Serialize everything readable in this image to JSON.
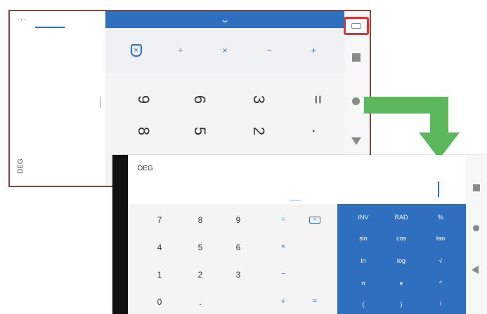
{
  "back_screen": {
    "overflow_menu": "···",
    "angle_mode": "DEG",
    "chevron": "⌄",
    "ops": [
      "÷",
      "×",
      "−",
      "+"
    ],
    "keys": [
      "9",
      "6",
      "3",
      "=",
      "8",
      "5",
      "2",
      "."
    ],
    "icons": {
      "rotate": "screen-rotate-icon",
      "clear": "clear-icon"
    }
  },
  "front_screen": {
    "angle_mode": "DEG",
    "menu_icon": "⋮",
    "numbers": [
      "7",
      "8",
      "9",
      "4",
      "5",
      "6",
      "1",
      "2",
      "3",
      "0",
      "."
    ],
    "ops": [
      "÷",
      "×",
      "−",
      "+",
      "="
    ],
    "sci": [
      "INV",
      "RAD",
      "%",
      "sin",
      "cos",
      "tan",
      "ln",
      "log",
      "√",
      "π",
      "e",
      "^",
      "(",
      ")",
      "!"
    ],
    "backspace_icon": "⌫"
  },
  "colors": {
    "accent": "#2f6fc0",
    "arrow": "#5cb85c",
    "highlight": "#e53030"
  }
}
